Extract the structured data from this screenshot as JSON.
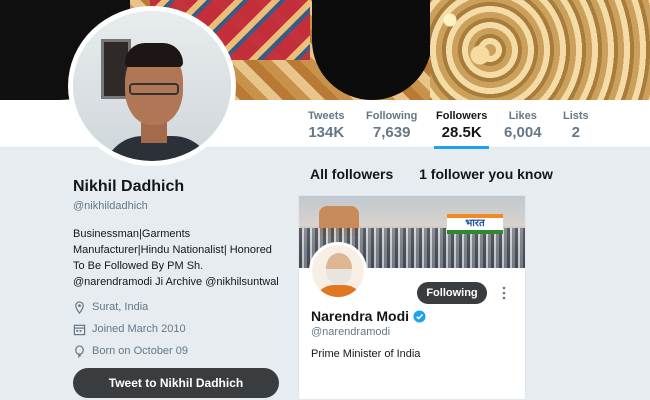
{
  "profile": {
    "name": "Nikhil Dadhich",
    "handle": "@nikhildadhich",
    "bio": "Businessman|Garments Manufacturer|Hindu Nationalist| Honored To Be Followed By PM Sh. @narendramodi Ji Archive @nikhilsuntwal",
    "location": "Surat, India",
    "joined": "Joined March 2010",
    "born": "Born on October 09",
    "tweet_button": "Tweet to Nikhil Dadhich"
  },
  "stats": {
    "tweets": {
      "label": "Tweets",
      "value": "134K"
    },
    "following": {
      "label": "Following",
      "value": "7,639"
    },
    "followers": {
      "label": "Followers",
      "value": "28.5K"
    },
    "likes": {
      "label": "Likes",
      "value": "6,004"
    },
    "lists": {
      "label": "Lists",
      "value": "2"
    }
  },
  "tabs": {
    "all_followers": "All followers",
    "you_know": "1 follower you know"
  },
  "card": {
    "banner_sign": "भारत",
    "follow_label": "Following",
    "name": "Narendra Modi",
    "handle": "@narendramodi",
    "bio": "Prime Minister of India"
  },
  "colors": {
    "accent": "#1da1f2",
    "button_dark": "#3a3d40",
    "page_bg": "#e6ecf0"
  }
}
